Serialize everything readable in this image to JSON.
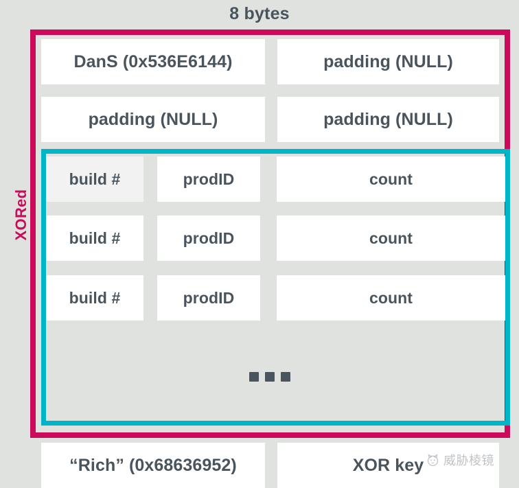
{
  "diagram": {
    "title": "8 bytes",
    "side_label": "XORed",
    "accent_pink": "#cc0a5a",
    "accent_cyan": "#00b5c8",
    "background": "#e0e2e0",
    "text_color": "#4a545c",
    "header_rows": [
      {
        "left": "DanS (0x536E6144)",
        "right": "padding (NULL)"
      },
      {
        "left": "padding (NULL)",
        "right": "padding (NULL)"
      }
    ],
    "entry_rows": [
      {
        "build": "build #",
        "prodid": "prodID",
        "count": "count"
      },
      {
        "build": "build #",
        "prodid": "prodID",
        "count": "count"
      },
      {
        "build": "build #",
        "prodid": "prodID",
        "count": "count"
      }
    ],
    "continuation": "...",
    "footer_row": {
      "left": "“Rich” (0x68636952)",
      "right": "XOR key"
    }
  },
  "watermark": {
    "text": "威胁棱镜",
    "icon": "cat-logo-icon"
  }
}
